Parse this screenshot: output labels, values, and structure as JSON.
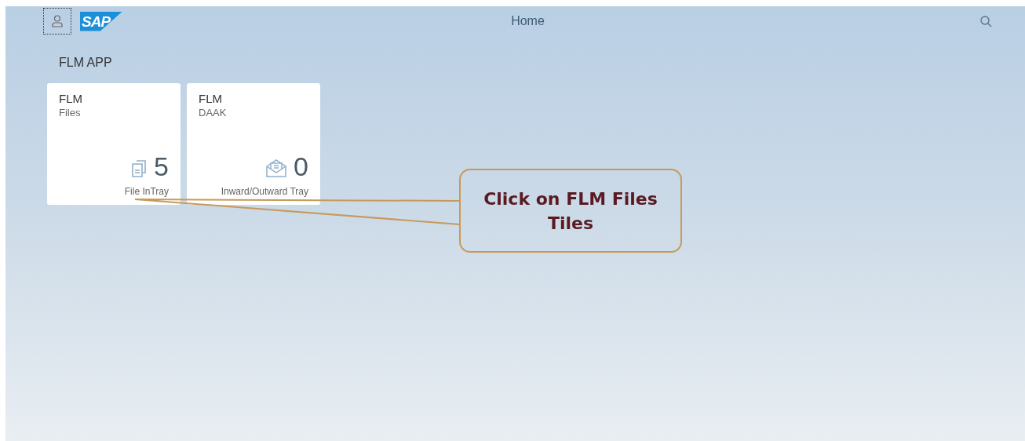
{
  "header": {
    "logo": "SAP",
    "title": "Home"
  },
  "group": {
    "title": "FLM APP"
  },
  "tiles": [
    {
      "title": "FLM",
      "subtitle": "Files",
      "kind": "files",
      "count": "5",
      "footer": "File InTray"
    },
    {
      "title": "FLM",
      "subtitle": "DAAK",
      "kind": "mail",
      "count": "0",
      "footer": "Inward/Outward Tray"
    }
  ],
  "callout": {
    "text": "Click on FLM Files Tiles"
  }
}
